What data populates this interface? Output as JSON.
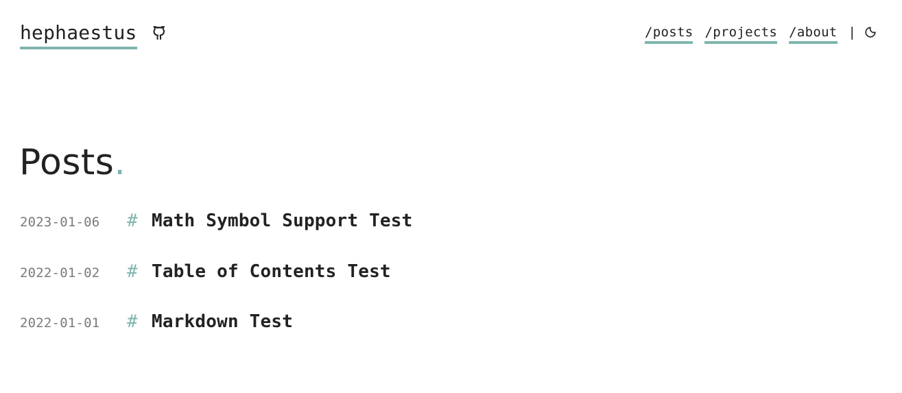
{
  "header": {
    "site_title": "hephaestus",
    "github_icon": "github-icon",
    "nav": [
      {
        "label": "/posts"
      },
      {
        "label": "/projects"
      },
      {
        "label": "/about"
      }
    ],
    "separator": "|",
    "theme_icon": "moon-icon"
  },
  "main": {
    "title": "Posts",
    "title_dot": ".",
    "posts": [
      {
        "date": "2023-01-06",
        "hash": "#",
        "title": "Math Symbol Support Test"
      },
      {
        "date": "2022-01-02",
        "hash": "#",
        "title": "Table of Contents Test"
      },
      {
        "date": "2022-01-01",
        "hash": "#",
        "title": "Markdown Test"
      }
    ]
  },
  "colors": {
    "accent": "#7fb5ad",
    "text": "#222222",
    "muted": "#7a7a7a",
    "background": "#ffffff"
  }
}
